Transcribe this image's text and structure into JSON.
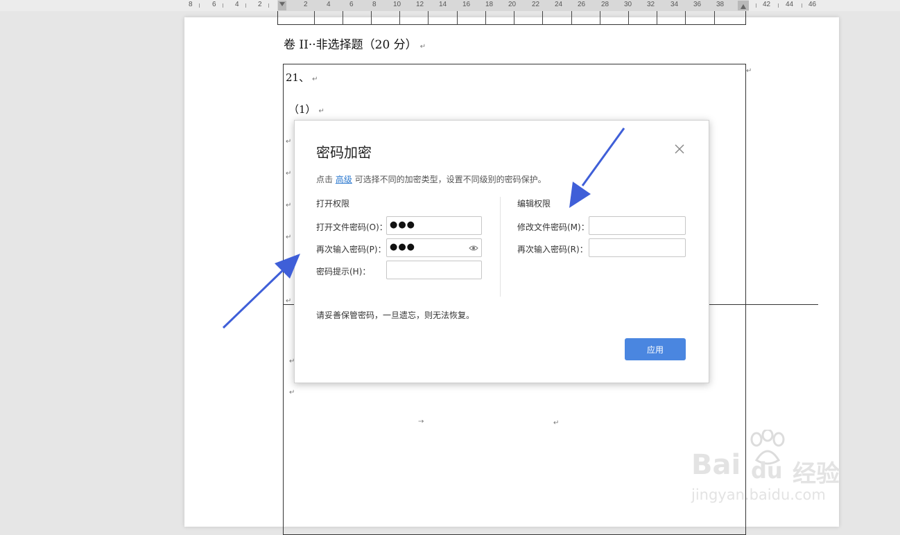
{
  "ruler": {
    "numbers": [
      "8",
      "6",
      "4",
      "2",
      "2",
      "4",
      "6",
      "8",
      "10",
      "12",
      "14",
      "16",
      "18",
      "20",
      "22",
      "24",
      "26",
      "28",
      "30",
      "32",
      "34",
      "36",
      "38",
      "42",
      "44",
      "46"
    ]
  },
  "document": {
    "heading": "卷 II··非选择题（20 分）",
    "q21": "21、",
    "q21_1": "（1）",
    "para_mark": "↵",
    "tab_mark": "→"
  },
  "dialog": {
    "title": "密码加密",
    "desc_prefix": "点击 ",
    "desc_link": "高级",
    "desc_suffix": " 可选择不同的加密类型，设置不同级别的密码保护。",
    "open_section": {
      "title": "打开权限",
      "open_password_label": "打开文件密码(O)：",
      "open_password_value": "●●●",
      "confirm_label": "再次输入密码(P)：",
      "confirm_value": "●●●",
      "hint_label": "密码提示(H)：",
      "hint_value": ""
    },
    "edit_section": {
      "title": "编辑权限",
      "modify_label": "修改文件密码(M)：",
      "modify_value": "",
      "confirm_label": "再次输入密码(R)：",
      "confirm_value": ""
    },
    "warning": "请妥善保管密码，一旦遗忘，则无法恢复。",
    "apply_label": "应用"
  },
  "watermark": {
    "brand": "Bai",
    "brand2": "du",
    "brand3": "经验",
    "url": "jingyan.baidu.com"
  },
  "colors": {
    "accent": "#4a86e0",
    "arrow": "#3f5fd8",
    "link": "#2f7bd0"
  }
}
